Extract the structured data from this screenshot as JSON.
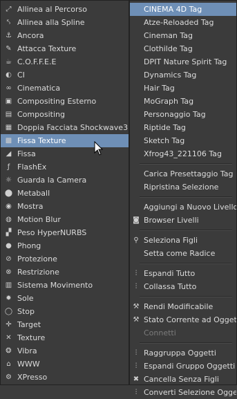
{
  "left_menu": [
    {
      "label": "Allinea al Percorso",
      "icon": "align-path-icon",
      "glyph": "⤢"
    },
    {
      "label": "Allinea alla Spline",
      "icon": "align-spline-icon",
      "glyph": "⤣"
    },
    {
      "label": "Ancora",
      "icon": "anchor-icon",
      "glyph": "⚓"
    },
    {
      "label": "Attacca Texture",
      "icon": "stick-texture-icon",
      "glyph": "✎"
    },
    {
      "label": "C.O.F.F.E.E",
      "icon": "coffee-icon",
      "glyph": "☕"
    },
    {
      "label": "CI",
      "icon": "ci-icon",
      "glyph": "◐"
    },
    {
      "label": "Cinematica",
      "icon": "kinematic-icon",
      "glyph": "∞"
    },
    {
      "label": "Compositing Esterno",
      "icon": "external-compositing-icon",
      "glyph": "▣"
    },
    {
      "label": "Compositing",
      "icon": "compositing-icon",
      "glyph": "▤"
    },
    {
      "label": "Doppia Facciata Shockwave3D",
      "icon": "double-sided-icon",
      "glyph": "▦"
    },
    {
      "label": "Fissa Texture",
      "icon": "fix-texture-icon",
      "glyph": "▩"
    },
    {
      "label": "Fissa",
      "icon": "fix-icon",
      "glyph": "◢"
    },
    {
      "label": "FlashEx",
      "icon": "flashex-icon",
      "glyph": "ƒ"
    },
    {
      "label": "Guarda la Camera",
      "icon": "look-at-camera-icon",
      "glyph": "☼"
    },
    {
      "label": "Metaball",
      "icon": "metaball-icon",
      "glyph": "⬤"
    },
    {
      "label": "Mostra",
      "icon": "display-icon",
      "glyph": "◉"
    },
    {
      "label": "Motion Blur",
      "icon": "motion-blur-icon",
      "glyph": "◍"
    },
    {
      "label": "Peso HyperNURBS",
      "icon": "hypernurbs-weight-icon",
      "glyph": "▞"
    },
    {
      "label": "Phong",
      "icon": "phong-icon",
      "glyph": "●"
    },
    {
      "label": "Protezione",
      "icon": "protection-icon",
      "glyph": "⊘"
    },
    {
      "label": "Restrizione",
      "icon": "restriction-icon",
      "glyph": "⊗"
    },
    {
      "label": "Sistema Movimento",
      "icon": "motion-system-icon",
      "glyph": "▥"
    },
    {
      "label": "Sole",
      "icon": "sun-icon",
      "glyph": "✹"
    },
    {
      "label": "Stop",
      "icon": "stop-icon",
      "glyph": "◯"
    },
    {
      "label": "Target",
      "icon": "target-icon",
      "glyph": "✛"
    },
    {
      "label": "Texture",
      "icon": "texture-icon",
      "glyph": "✕"
    },
    {
      "label": "Vibra",
      "icon": "vibrate-icon",
      "glyph": "❂"
    },
    {
      "label": "WWW",
      "icon": "www-icon",
      "glyph": "⌂"
    },
    {
      "label": "XPresso",
      "icon": "xpresso-icon",
      "glyph": "⚙"
    }
  ],
  "selected_left_index": 10,
  "right_menu": [
    {
      "label": "CINEMA 4D Tag",
      "type": "header"
    },
    {
      "label": "Atze-Reloaded Tag",
      "type": "item"
    },
    {
      "label": "Cineman Tag",
      "type": "item"
    },
    {
      "label": "Clothilde Tag",
      "type": "item"
    },
    {
      "label": "DPIT Nature Spirit Tag",
      "type": "item"
    },
    {
      "label": "Dynamics Tag",
      "type": "item"
    },
    {
      "label": "Hair Tag",
      "type": "item"
    },
    {
      "label": "MoGraph Tag",
      "type": "item"
    },
    {
      "label": "Personaggio Tag",
      "type": "item"
    },
    {
      "label": "Riptide Tag",
      "type": "item"
    },
    {
      "label": "Sketch Tag",
      "type": "item"
    },
    {
      "label": "Xfrog43_221106 Tag",
      "type": "item"
    },
    {
      "type": "separator"
    },
    {
      "label": "Carica Presettaggio Tag",
      "type": "item"
    },
    {
      "label": "Ripristina Selezione",
      "type": "item"
    },
    {
      "type": "separator"
    },
    {
      "label": "Aggiungi a Nuovo Livello",
      "type": "item"
    },
    {
      "label": "Browser Livelli",
      "type": "item",
      "icon": "layer-browser-icon",
      "glyph": "◙"
    },
    {
      "type": "separator"
    },
    {
      "label": "Seleziona Figli",
      "type": "item",
      "icon": "select-children-icon",
      "glyph": "⚲"
    },
    {
      "label": "Setta come Radice",
      "type": "item"
    },
    {
      "type": "separator"
    },
    {
      "label": "Espandi Tutto",
      "type": "item",
      "icon": "expand-all-icon",
      "glyph": "⫶"
    },
    {
      "label": "Collassa Tutto",
      "type": "item",
      "icon": "collapse-all-icon",
      "glyph": "⫶"
    },
    {
      "type": "separator"
    },
    {
      "label": "Rendi Modificabile",
      "type": "item",
      "icon": "make-editable-icon",
      "glyph": "⚒"
    },
    {
      "label": "Stato Corrente ad Oggetto",
      "type": "item",
      "icon": "current-state-icon",
      "glyph": "⚒"
    },
    {
      "label": "Connetti",
      "type": "disabled"
    },
    {
      "type": "separator"
    },
    {
      "label": "Raggruppa Oggetti",
      "type": "item",
      "icon": "group-objects-icon",
      "glyph": "⫶"
    },
    {
      "label": "Espandi Gruppo Oggetti",
      "type": "item",
      "icon": "expand-group-icon",
      "glyph": "⫶"
    },
    {
      "label": "Cancella Senza Figli",
      "type": "item",
      "icon": "delete-no-children-icon",
      "glyph": "✖"
    },
    {
      "label": "Converti Selezione Oggetto in",
      "type": "item",
      "icon": "convert-selection-icon",
      "glyph": "⫶"
    }
  ],
  "colors": {
    "highlight": "#6e8fb6",
    "background": "#3b3b3b",
    "text": "#dcdcdc"
  }
}
